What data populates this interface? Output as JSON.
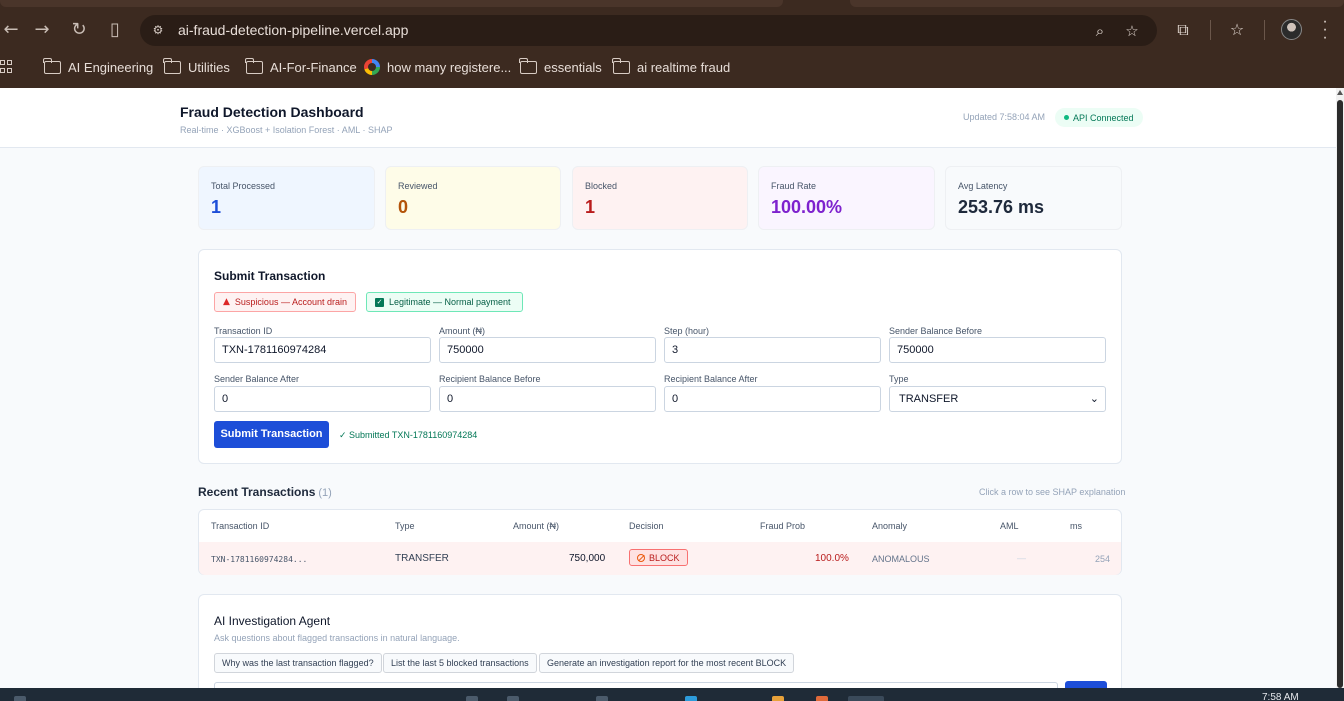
{
  "browser": {
    "url": "ai-fraud-detection-pipeline.vercel.app",
    "bookmarks": [
      {
        "label": "AI Engineering",
        "icon": "folder-icon"
      },
      {
        "label": "Utilities",
        "icon": "folder-icon"
      },
      {
        "label": "AI-For-Finance",
        "icon": "folder-icon"
      },
      {
        "label": "how many registere...",
        "icon": "google-icon"
      },
      {
        "label": "essentials",
        "icon": "folder-icon"
      },
      {
        "label": "ai realtime fraud",
        "icon": "folder-icon"
      }
    ]
  },
  "header": {
    "title": "Fraud Detection Dashboard",
    "subtitle": "Real-time · XGBoost + Isolation Forest · AML · SHAP",
    "updated": "Updated 7:58:04 AM",
    "api_status": "API Connected"
  },
  "stats": [
    {
      "label": "Total Processed",
      "value": "1",
      "color": "#1d4ed8",
      "bg": "#eff6ff"
    },
    {
      "label": "Reviewed",
      "value": "0",
      "color": "#b45309",
      "bg": "#fefce8"
    },
    {
      "label": "Blocked",
      "value": "1",
      "color": "#b91c1c",
      "bg": "#fef2f2"
    },
    {
      "label": "Fraud Rate",
      "value": "100.00%",
      "color": "#7e22ce",
      "bg": "#faf5ff"
    },
    {
      "label": "Avg Latency",
      "value": "253.76 ms",
      "color": "#1e293b",
      "bg": "#f8fafc"
    }
  ],
  "submit": {
    "title": "Submit Transaction",
    "preset_suspicious": "Suspicious — Account drain",
    "preset_legit": "Legitimate — Normal payment",
    "fields": {
      "txn_id": {
        "label": "Transaction ID",
        "value": "TXN-1781160974284"
      },
      "amount": {
        "label": "Amount (₦)",
        "value": "750000"
      },
      "step": {
        "label": "Step (hour)",
        "value": "3"
      },
      "sender_before": {
        "label": "Sender Balance Before",
        "value": "750000"
      },
      "sender_after": {
        "label": "Sender Balance After",
        "value": "0"
      },
      "recipient_before": {
        "label": "Recipient Balance Before",
        "value": "0"
      },
      "recipient_after": {
        "label": "Recipient Balance After",
        "value": "0"
      },
      "type": {
        "label": "Type",
        "value": "TRANSFER"
      }
    },
    "button": "Submit Transaction",
    "status": "✓ Submitted TXN-1781160974284"
  },
  "recent": {
    "title": "Recent Transactions",
    "count": "(1)",
    "hint": "Click a row to see SHAP explanation",
    "columns": [
      "Transaction ID",
      "Type",
      "Amount (₦)",
      "Decision",
      "Fraud Prob",
      "Anomaly",
      "AML",
      "ms"
    ],
    "rows": [
      {
        "id": "TXN-1781160974284...",
        "type": "TRANSFER",
        "amount": "750,000",
        "decision": "BLOCK",
        "prob": "100.0%",
        "anomaly": "ANOMALOUS",
        "aml": "—",
        "ms": "254"
      }
    ]
  },
  "agent": {
    "title": "AI Investigation Agent",
    "subtitle": "Ask questions about flagged transactions in natural language.",
    "suggestions": [
      "Why was the last transaction flagged?",
      "List the last 5 blocked transactions",
      "Generate an investigation report for the most recent BLOCK"
    ]
  },
  "taskbar": {
    "clock": "7:58 AM"
  }
}
